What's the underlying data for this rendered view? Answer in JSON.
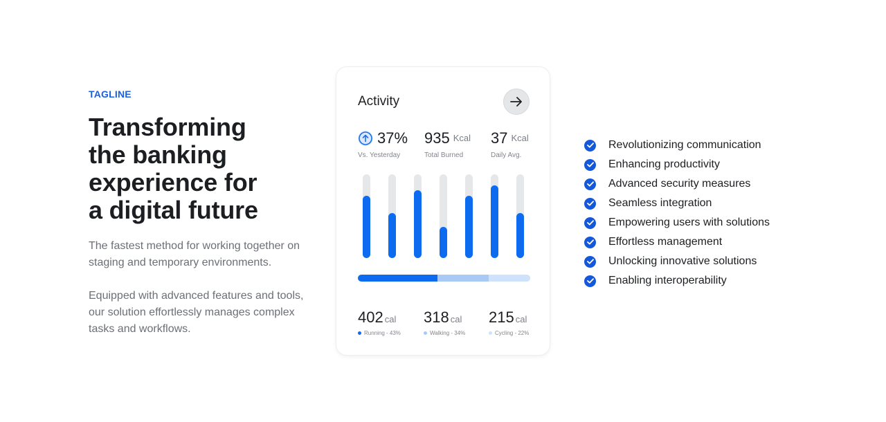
{
  "hero": {
    "tagline": "TAGLINE",
    "headline_lines": [
      "Transforming",
      "the banking",
      "experience for",
      "a digital future"
    ],
    "paragraph1": "The fastest method for working together on staging and temporary environments.",
    "paragraph2": "Equipped with advanced features and tools, our solution effortlessly manages complex tasks and workflows."
  },
  "card": {
    "title": "Activity",
    "arrow_icon": "arrow-right-icon",
    "stats": [
      {
        "value": "37%",
        "unit": "",
        "label": "Vs. Yesterday",
        "icon": "arrow-up-circle-icon"
      },
      {
        "value": "935",
        "unit": "Kcal",
        "label": "Total Burned"
      },
      {
        "value": "37",
        "unit": "Kcal",
        "label": "Daily Avg."
      }
    ],
    "bar_levels": [
      0.74,
      0.54,
      0.81,
      0.37,
      0.74,
      0.87,
      0.54
    ],
    "progress": [
      {
        "name": "Running",
        "percent": 46,
        "color": "#0d6bf0"
      },
      {
        "name": "Walking",
        "percent": 30,
        "color": "#a8c9f5"
      },
      {
        "name": "Cycling",
        "percent": 24,
        "color": "#cfe2fb"
      }
    ],
    "calories": [
      {
        "value": "402",
        "unit": "cal",
        "label": "Running - 43%",
        "color": "#0d6bf0"
      },
      {
        "value": "318",
        "unit": "cal",
        "label": "Walking - 34%",
        "color": "#a8c9f5"
      },
      {
        "value": "215",
        "unit": "cal",
        "label": "Cycling - 22%",
        "color": "#cfe2fb"
      }
    ]
  },
  "features": [
    "Revolutionizing communication",
    "Enhancing productivity",
    "Advanced security measures",
    "Seamless integration",
    "Empowering users with solutions",
    "Effortless management",
    "Unlocking innovative solutions",
    "Enabling interoperability"
  ],
  "colors": {
    "accent": "#1b5fe0",
    "bar": "#0d6bf0",
    "check": "#1358dc"
  }
}
